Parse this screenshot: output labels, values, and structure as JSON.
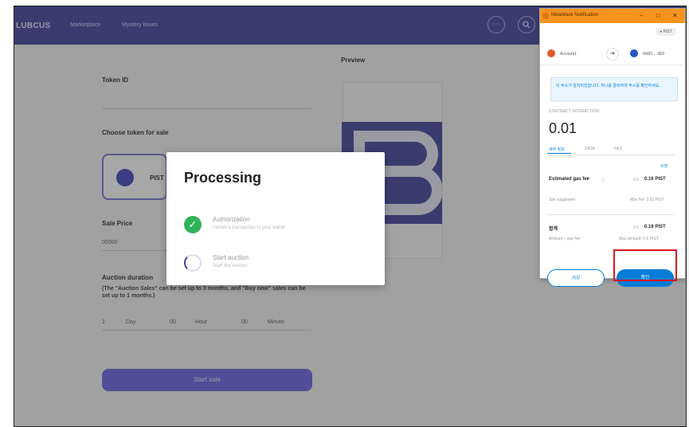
{
  "navbar": {
    "brand": "LUBCUS",
    "links": [
      "Marketplace",
      "Mystery boxes"
    ],
    "more_icon": "ellipsis-icon",
    "search_icon": "search-icon"
  },
  "form": {
    "token_id_label": "Token ID",
    "choose_token_label": "Choose token for sale",
    "token_name": "PIST",
    "sale_price_label": "Sale Price",
    "sale_price_value": "00000",
    "auction_label": "Auction duration",
    "auction_help": "(The \"Auction Sales\" can be set up to 3 months, and \"Buy now\" sales can be set up to 1 months.)",
    "duration_day_value": "1",
    "duration_day_unit": "Day",
    "duration_hour_value": "00",
    "duration_hour_unit": "Hour",
    "duration_minute_value": "00",
    "duration_minute_unit": "Minute",
    "start_button": "Start sale",
    "preview_label": "Preview"
  },
  "modal": {
    "title": "Processing",
    "steps": [
      {
        "title": "Authorization",
        "subtitle": "Initiate a transaction to your wallet",
        "status": "done"
      },
      {
        "title": "Start auction",
        "subtitle": "Start the auction",
        "status": "in-progress"
      }
    ]
  },
  "metamask": {
    "window_title": "MetaMask Notification",
    "controls": [
      "–",
      "□",
      "✕"
    ],
    "network": "● PIST",
    "from_account": "Account1",
    "to_account": "0x6FL...2E9",
    "notice": "이 주소가 일치되었습니다. 하나를 클릭하여 주소를 확인하세요.",
    "contract_label": "CONTRACT INTERACTION",
    "amount": "0.01",
    "tabs": [
      "세부 정보",
      "DATA",
      "HEX"
    ],
    "edit_label": "수정",
    "gas_label": "Estimated gas fee",
    "gas_suggested": "Site suggested",
    "gas_value": "0.16 PIST",
    "gas_value_prefix": "0.0",
    "max_fee": "Max fee: 0.01 PIST",
    "total_label": "합계",
    "total_sub": "Amount + gas fee",
    "total_value": "0.16 PIST",
    "total_prefix": "0.0",
    "max_amount": "Max amount: 0.6 PIST",
    "reject_button": "거부",
    "confirm_button": "확인"
  },
  "colors": {
    "nav": "#3b3d98",
    "accent": "#5d5fe0",
    "success": "#2fb35a",
    "metamask_orange": "#f7941d",
    "metamask_blue": "#037dd6",
    "highlight": "#e0141e"
  }
}
